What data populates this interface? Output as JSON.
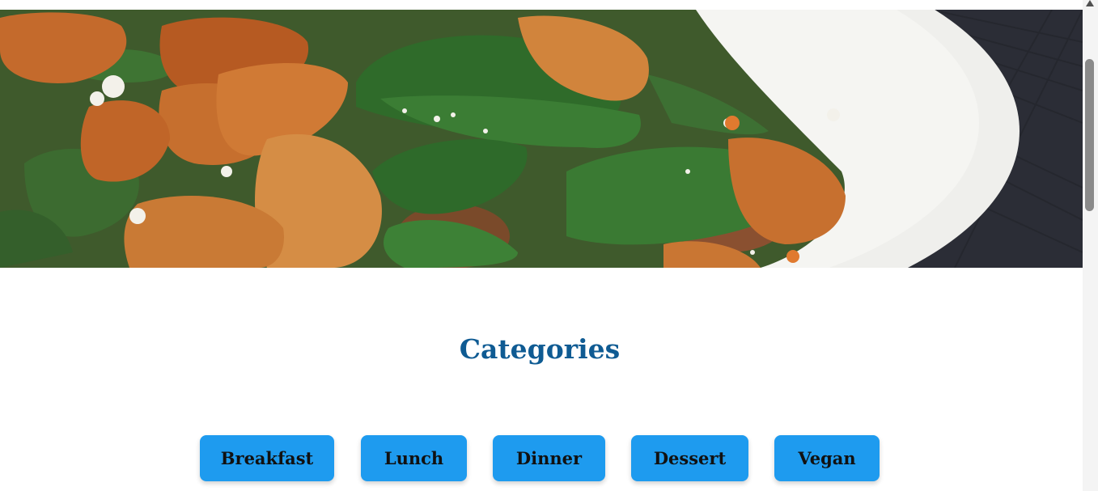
{
  "hero": {
    "image_description": "salad-chicken-spinach-photo"
  },
  "categories": {
    "title": "Categories",
    "items": [
      {
        "label": "Breakfast"
      },
      {
        "label": "Lunch"
      },
      {
        "label": "Dinner"
      },
      {
        "label": "Dessert"
      },
      {
        "label": "Vegan"
      }
    ]
  },
  "colors": {
    "title": "#0f5b93",
    "button_bg": "#1e9bef",
    "button_text": "#111111"
  }
}
